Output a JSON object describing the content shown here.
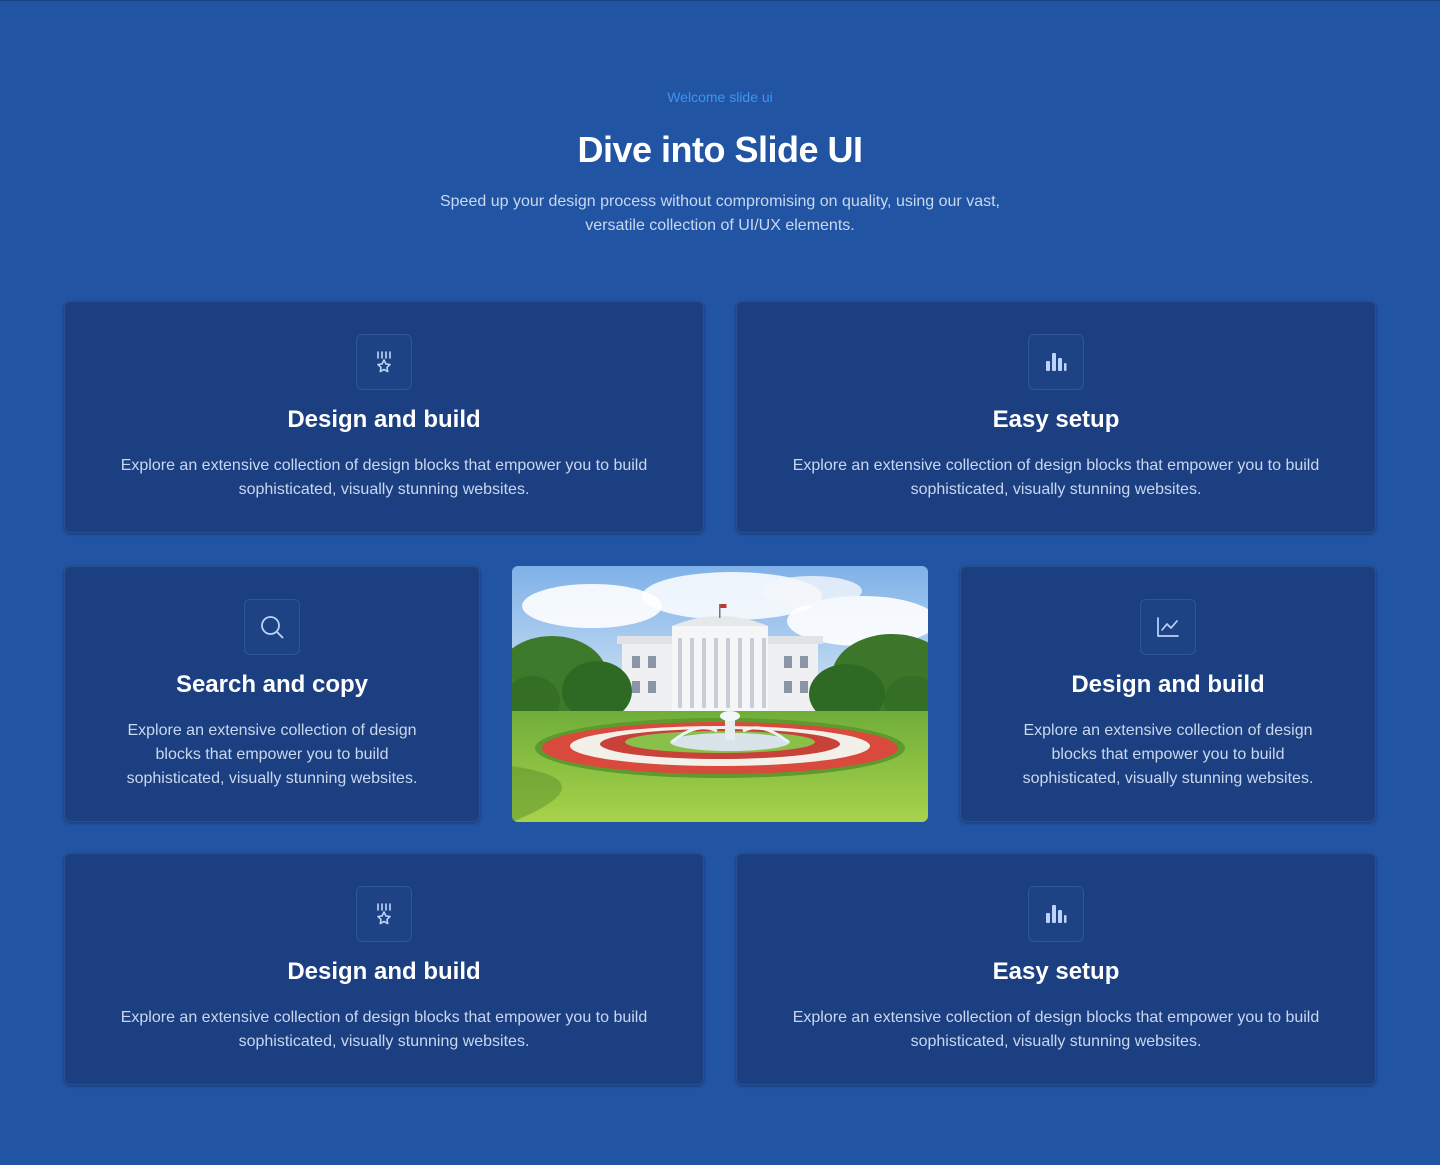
{
  "header": {
    "eyebrow": "Welcome slide ui",
    "title": "Dive into Slide UI",
    "subtitle": "Speed up your design process without compromising on quality, using our vast, versatile collection of UI/UX elements."
  },
  "colors": {
    "background": "#2254a4",
    "card": "#1b3f80",
    "accent": "#3d95f0",
    "icon": "#bcd4fb"
  },
  "cards": [
    {
      "icon": "medal-star-icon",
      "title": "Design and build",
      "description": "Explore an extensive collection of design blocks that empower you to build sophisticated, visually stunning websites."
    },
    {
      "icon": "bar-chart-icon",
      "title": "Easy setup",
      "description": "Explore an extensive collection of design blocks that empower you to build sophisticated, visually stunning websites."
    },
    {
      "icon": "search-icon",
      "title": "Search and copy",
      "description": "Explore an extensive collection of design blocks that empower you to build sophisticated, visually stunning websites."
    },
    {
      "icon": "line-chart-icon",
      "title": "Design and build",
      "description": "Explore an extensive collection of design blocks that empower you to build sophisticated, visually stunning websites."
    },
    {
      "icon": "medal-star-icon",
      "title": "Design and build",
      "description": "Explore an extensive collection of design blocks that empower you to build sophisticated, visually stunning websites."
    },
    {
      "icon": "bar-chart-icon",
      "title": "Easy setup",
      "description": "Explore an extensive collection of design blocks that empower you to build sophisticated, visually stunning websites."
    }
  ],
  "image": {
    "subject": "white-house-garden-photo"
  }
}
